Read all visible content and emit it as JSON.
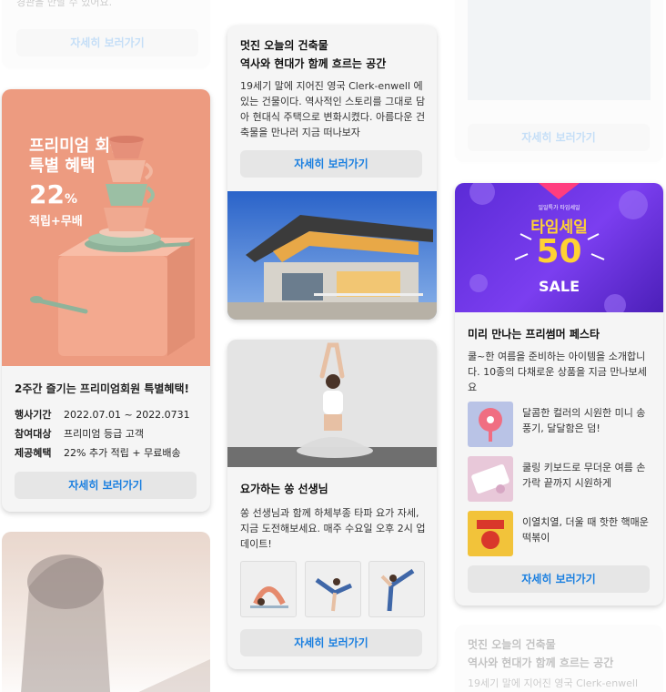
{
  "column1_top": {
    "desc_fragment": "경관을 만날 수 있어요.",
    "button_label": "자세히 보러가기"
  },
  "premium": {
    "banner_line1": "프리미엄 회원",
    "banner_line2": "특별 혜택",
    "banner_percent": "22",
    "banner_percent_sign": "%",
    "banner_line4": "적립+무배",
    "heading": "2주간 즐기는 프리미엄회원 특별혜택!",
    "info": [
      {
        "label": "행사기간",
        "value": "2022.07.01 ~ 2022.0731"
      },
      {
        "label": "참여대상",
        "value": "프리미엄 등급 고객"
      },
      {
        "label": "제공혜택",
        "value": "22% 추가 적립 + 무료배송"
      }
    ],
    "button_label": "자세히 보러가기"
  },
  "architecture": {
    "title_line1": "멋진 오늘의 건축물",
    "title_line2": "역사와 현대가 함께 흐르는 공간",
    "desc": "19세기 말에 지어진 영국 Clerk-enwell 에 있는 건물이다. 역사적인 스토리를 그대로 담아 현대식 주택으로 변화시켰다. 아름다운 건축물을 만나러 지금 떠나보자",
    "button_label": "자세히 보러가기"
  },
  "yoga": {
    "title": "요가하는 쏭 선생님",
    "desc": "쏭 선생님과 함께 하체부종 타파 요가 자세, 지금 도전해보세요. 매주 수요일 오후 2시 업데이트!",
    "button_label": "자세히 보러가기"
  },
  "column3_top": {
    "button_label": "자세히 보러가기"
  },
  "summer": {
    "banner_small": "일일특가 타임세일",
    "banner_title": "타임세일",
    "banner_number": "50",
    "banner_sale": "SALE",
    "title": "미리 만나는 프리썸머 페스타",
    "desc": "쿨~한 여름을 준비하는 아이템을 소개합니다. 10종의 다채로운 상품을 지금 만나보세요",
    "products": [
      {
        "text": "달콤한 컬러의 시원한 미니 송풍기, 달달함은 덤!"
      },
      {
        "text": "쿨링 키보드로 무더운 여름 손가락 끝까지 시원하게"
      },
      {
        "text": "이열치열, 더울 때 핫한 핵매운 떡볶이"
      }
    ],
    "button_label": "자세히 보러가기"
  },
  "column3_bottom": {
    "title_line1": "멋진 오늘의 건축물",
    "title_line2": "역사와 현대가 함께 흐르는 공간",
    "desc_fragment": "19세기 말에 지어진 영국 Clerk-enwell"
  },
  "colors": {
    "link_blue": "#1a7fe0",
    "premium_banner": "#ed9b80",
    "summer_banner": "#6a34e6"
  }
}
